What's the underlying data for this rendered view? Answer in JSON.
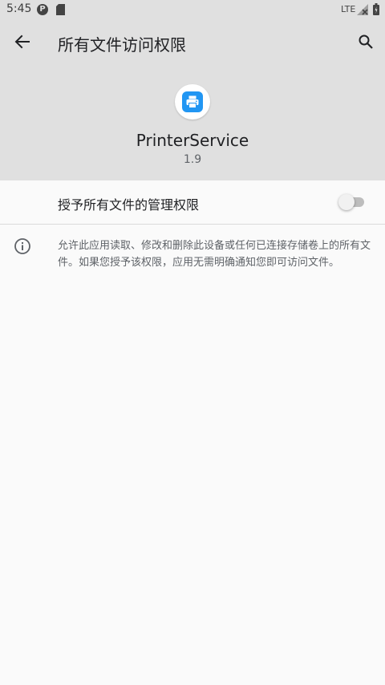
{
  "status_bar": {
    "time": "5:45",
    "network": "LTE",
    "p_icon_letter": "P"
  },
  "toolbar": {
    "title": "所有文件访问权限",
    "back_icon": "arrow-back-icon",
    "search_icon": "search-icon"
  },
  "app": {
    "name": "PrinterService",
    "version": "1.9",
    "icon": "printer-icon",
    "icon_color": "#2196f3"
  },
  "permission": {
    "label": "授予所有文件的管理权限",
    "enabled": false
  },
  "info": {
    "icon": "info-icon",
    "text": "允许此应用读取、修改和删除此设备或任何已连接存储卷上的所有文件。如果您授予该权限，应用无需明确通知您即可访问文件。"
  },
  "colors": {
    "header_bg": "#e0e0e0",
    "body_bg": "#fafafa",
    "accent": "#2196f3"
  }
}
